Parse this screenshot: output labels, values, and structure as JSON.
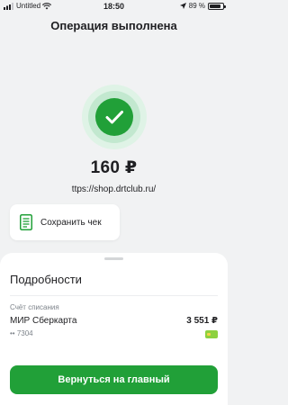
{
  "status_bar": {
    "carrier": "Untitled",
    "time": "18:50",
    "battery_text": "89 %",
    "battery_level": 0.89,
    "icons": [
      "signal-bars-icon",
      "wifi-icon",
      "location-arrow-icon",
      "battery-icon"
    ]
  },
  "header": {
    "title": "Операция выполнена"
  },
  "result": {
    "status_icon": "check-icon",
    "amount": "160 ₽",
    "merchant": "ttps://shop.drtclub.ru/"
  },
  "actions": {
    "save_receipt_label": "Сохранить чек",
    "save_receipt_icon": "document-icon"
  },
  "details": {
    "title": "Подробности",
    "account_caption": "Счёт списания",
    "card_name": "МИР Сберкарта",
    "card_number": "•• 7304",
    "card_balance": "3 551 ₽",
    "card_icon": "card-icon"
  },
  "footer": {
    "home_button_label": "Вернуться на главный"
  },
  "colors": {
    "accent": "#21a038",
    "background": "#f1f2f3",
    "card_icon": "#8dd13f"
  }
}
